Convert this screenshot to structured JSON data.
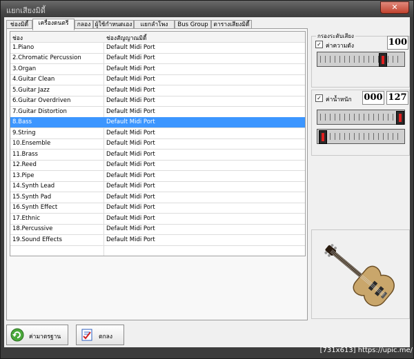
{
  "window": {
    "title": "แยกเสียงมิดี้",
    "close_glyph": "✕"
  },
  "tabs": [
    {
      "label": "ช่องมิดี้"
    },
    {
      "label": "เครื่องดนตรี"
    },
    {
      "label": "กลอง"
    },
    {
      "label": "ผู้ใช้กำหนดเอง"
    },
    {
      "label": "แยกลำโพง"
    },
    {
      "label": "Bus Group"
    },
    {
      "label": "ตารางเสียงมิดี้"
    }
  ],
  "active_tab": 1,
  "table": {
    "columns": [
      "ช่อง",
      "ช่องสัญญาณมิดี้"
    ],
    "rows": [
      [
        "1.Piano",
        "Default Midi Port"
      ],
      [
        "2.Chromatic Percussion",
        "Default Midi Port"
      ],
      [
        "3.Organ",
        "Default Midi Port"
      ],
      [
        "4.Guitar Clean",
        "Default Midi Port"
      ],
      [
        "5.Guitar Jazz",
        "Default Midi Port"
      ],
      [
        "6.Guitar Overdriven",
        "Default Midi Port"
      ],
      [
        "7.Guitar Distortion",
        "Default Midi Port"
      ],
      [
        "8.Bass",
        "Default Midi Port"
      ],
      [
        "9.String",
        "Default Midi Port"
      ],
      [
        "10.Ensemble",
        "Default Midi Port"
      ],
      [
        "11.Brass",
        "Default Midi Port"
      ],
      [
        "12.Reed",
        "Default Midi Port"
      ],
      [
        "13.Pipe",
        "Default Midi Port"
      ],
      [
        "14.Synth Lead",
        "Default Midi Port"
      ],
      [
        "15.Synth Pad",
        "Default Midi Port"
      ],
      [
        "16.Synth Effect",
        "Default Midi Port"
      ],
      [
        "17.Ethnic",
        "Default Midi Port"
      ],
      [
        "18.Percussive",
        "Default Midi Port"
      ],
      [
        "19.Sound Effects",
        "Default Midi Port"
      ]
    ],
    "selected_index": 7
  },
  "volume_group": {
    "title": "กรองระดับเสียง",
    "checkbox_label": "ค่าความดัง",
    "checked": true,
    "value": "100",
    "slider_fraction": 0.78
  },
  "weight_group": {
    "checkbox_label": "ค่าน้ำหนัก",
    "checked": true,
    "min_value": "000",
    "max_value": "127",
    "max_slider_fraction": 1.0,
    "min_slider_fraction": 0.0
  },
  "image": {
    "icon": "bass-guitar-icon"
  },
  "buttons": {
    "default_label": "ค่ามาตรฐาน",
    "ok_label": "ตกลง"
  },
  "watermark": "[731x613] https://upic.me/",
  "colors": {
    "selection": "#3c96ff",
    "titlebar": "#4a4a4a",
    "close": "#c2432f"
  }
}
